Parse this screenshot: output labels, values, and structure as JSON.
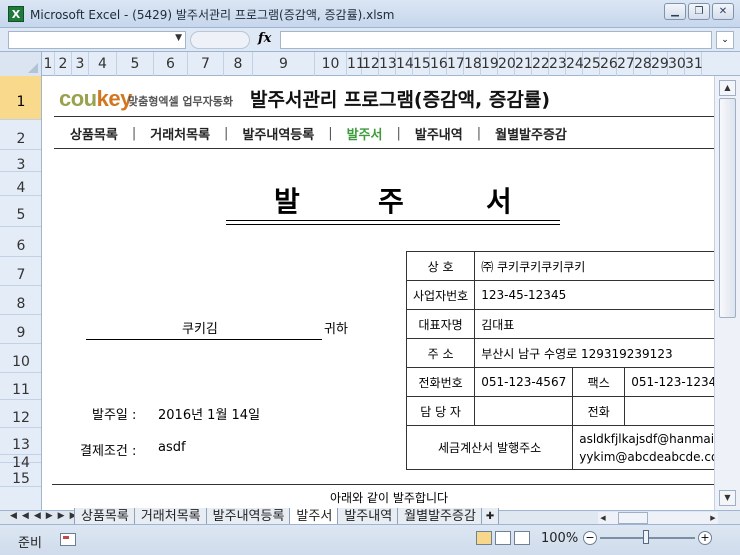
{
  "window": {
    "title": "Microsoft Excel - (5429) 발주서관리 프로그램(증감액, 증감률).xlsm",
    "app_icon": "X",
    "controls": [
      "minimize-icon",
      "restore-icon",
      "close-icon"
    ]
  },
  "formula_bar": {
    "name_box": "",
    "fx_label": "fx",
    "formula": ""
  },
  "columns": [
    "1",
    "2",
    "3",
    "4",
    "5",
    "6",
    "7",
    "8",
    "9",
    "10",
    "11",
    "12",
    "13",
    "14",
    "15",
    "16",
    "17",
    "18",
    "19",
    "20",
    "21",
    "22",
    "23",
    "24",
    "25",
    "26",
    "27",
    "28",
    "29",
    "30",
    "31"
  ],
  "rows": [
    "1",
    "2",
    "3",
    "4",
    "5",
    "6",
    "7",
    "8",
    "9",
    "10",
    "11",
    "12",
    "13",
    "14",
    "15"
  ],
  "header": {
    "logo_main": "cou",
    "logo_accent": "key",
    "logo_tagline": "맞춤형엑셀 업무자동화",
    "program_title": "발주서관리 프로그램(증감액, 증감률)"
  },
  "menu": {
    "items": [
      {
        "label": "상품목록",
        "active": false
      },
      {
        "label": "거래처목록",
        "active": false
      },
      {
        "label": "발주내역등록",
        "active": false
      },
      {
        "label": "발주서",
        "active": true
      },
      {
        "label": "발주내역",
        "active": false
      },
      {
        "label": "월별발주증감",
        "active": false
      }
    ],
    "separator": "|"
  },
  "document": {
    "title_chars": [
      "발",
      "주",
      "서"
    ],
    "recipient": "쿠키김",
    "honorific": "귀하",
    "order_date_label": "발주일 :",
    "order_date": "2016년 1월 14일",
    "payment_label": "결제조건 :",
    "payment_value": "asdf",
    "intro": "아래와 같이 발주합니다"
  },
  "supplier": {
    "company_label": "상      호",
    "company_value": "㈜ 쿠키쿠키쿠키쿠키",
    "biznum_label": "사업자번호",
    "biznum_value": "123-45-12345",
    "ceo_label": "대표자명",
    "ceo_value": "김대표",
    "address_label": "주      소",
    "address_value": "부산시 남구 수영로 129319239123",
    "phone_label": "전화번호",
    "phone_value": "051-123-4567",
    "fax_label": "팩스",
    "fax_value": "051-123-1234",
    "manager_label": "담 당 자",
    "manager_value": "",
    "manager_phone_label": "전화",
    "manager_phone_value": "",
    "tax_email_label": "세금계산서 발행주소",
    "tax_email_1": "asldkfjlkajsdf@hanmail.net",
    "tax_email_2": "yykim@abcdeabcde.com"
  },
  "sheet_tabs": [
    {
      "label": "상품목록",
      "active": false
    },
    {
      "label": "거래처목록",
      "active": false
    },
    {
      "label": "발주내역등록",
      "active": false
    },
    {
      "label": "발주서",
      "active": true
    },
    {
      "label": "발주내역",
      "active": false
    },
    {
      "label": "월별발주증감",
      "active": false
    }
  ],
  "status": {
    "ready": "준비",
    "zoom": "100%",
    "zoom_level": 100
  }
}
